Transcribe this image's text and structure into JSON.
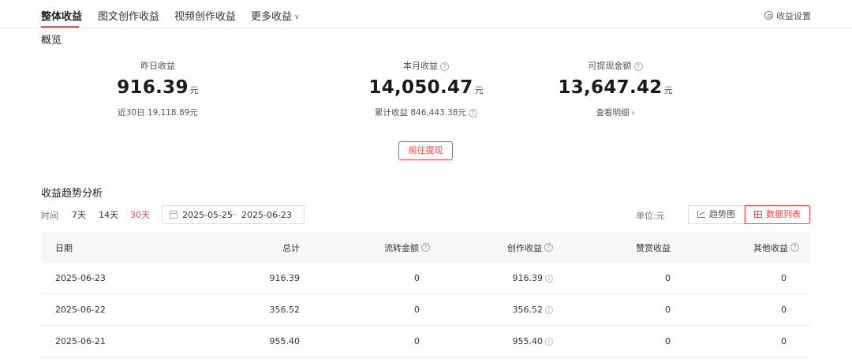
{
  "tabs": [
    {
      "label": "整体收益",
      "active": true
    },
    {
      "label": "图文创作收益",
      "active": false
    },
    {
      "label": "视频创作收益",
      "active": false
    },
    {
      "label": "更多收益",
      "active": false
    }
  ],
  "settings_label": "收益设置",
  "overview": {
    "title": "概览",
    "cards": [
      {
        "label": "昨日收益",
        "value": "916.39",
        "unit": "元",
        "sub": "近30日 19,118.89元"
      },
      {
        "label": "本月收益",
        "value": "14,050.47",
        "unit": "元",
        "sub": "累计收益 846,443.38元"
      },
      {
        "label": "可提现金额",
        "value": "13,647.42",
        "unit": "元",
        "sub": "查看明细"
      }
    ],
    "withdraw_button": "前往提现"
  },
  "trend": {
    "title": "收益趋势分析",
    "time_label": "时间",
    "ranges": [
      {
        "label": "7天",
        "active": false
      },
      {
        "label": "14天",
        "active": false
      },
      {
        "label": "30天",
        "active": true
      }
    ],
    "date_start": "2025-05-25",
    "date_sep": "~",
    "date_end": "2025-06-23",
    "unit_label": "单位:元",
    "view_trend": "趋势图",
    "view_list": "数据列表"
  },
  "table": {
    "columns": [
      "日期",
      "总计",
      "流转金额",
      "创作收益",
      "赞赏收益",
      "其他收益"
    ],
    "rows": [
      [
        "2025-06-23",
        "916.39",
        "0",
        "916.39",
        "0",
        "0"
      ],
      [
        "2025-06-22",
        "356.52",
        "0",
        "356.52",
        "0",
        "0"
      ],
      [
        "2025-06-21",
        "955.40",
        "0",
        "955.40",
        "0",
        "0"
      ]
    ]
  },
  "colors": {
    "accent": "#f0494a",
    "header_bg": "#f7f7f8",
    "border": "#eeeeee"
  }
}
